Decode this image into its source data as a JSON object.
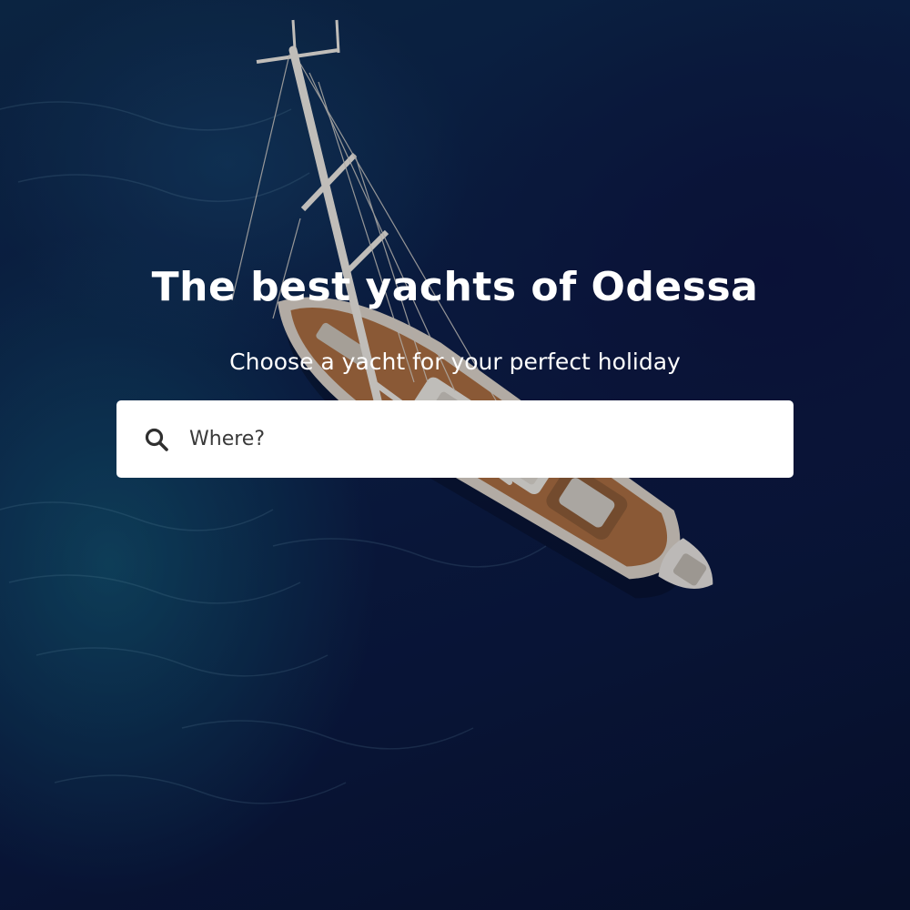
{
  "hero": {
    "title": "The best yachts of Odessa",
    "subtitle": "Choose a yacht for your perfect holiday"
  },
  "search": {
    "placeholder": "Where?",
    "value": "",
    "icon": "search-icon"
  },
  "background": {
    "description_icon": "yacht-aerial-photo",
    "colors": {
      "sea_dark": "#09163b",
      "sea_teal": "#146e82",
      "deck_wood": "#a86b3c",
      "hull_white": "#e8e4dc"
    }
  }
}
